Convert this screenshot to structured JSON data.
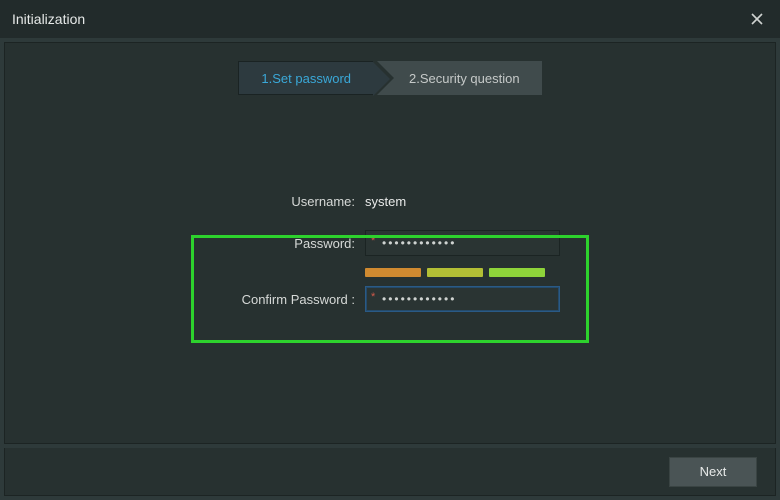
{
  "window": {
    "title": "Initialization"
  },
  "steps": {
    "step1": "1.Set password",
    "step2": "2.Security question"
  },
  "form": {
    "username_label": "Username:",
    "username_value": "system",
    "password_label": "Password:",
    "password_value": "••••••••••••",
    "confirm_label": "Confirm Password :",
    "confirm_value": "••••••••••••"
  },
  "buttons": {
    "next": "Next"
  }
}
